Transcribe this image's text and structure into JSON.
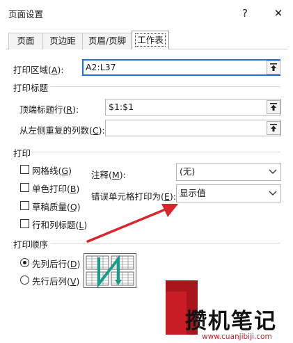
{
  "dialog": {
    "title": "页面设置",
    "help_button": "?",
    "close_button": "✕"
  },
  "tabs": [
    {
      "label": "页面"
    },
    {
      "label": "页边距"
    },
    {
      "label": "页眉/页脚"
    },
    {
      "label": "工作表",
      "active": true
    }
  ],
  "print_area": {
    "label": "打印区域",
    "hotkey": "A",
    "value": "A2:L37"
  },
  "print_titles": {
    "section": "打印标题",
    "rows_label": "顶端标题行",
    "rows_hotkey": "R",
    "rows_value": "$1:$1",
    "cols_label": "从左侧重复的列数",
    "cols_hotkey": "C",
    "cols_value": ""
  },
  "print": {
    "section": "打印",
    "checkboxes": [
      {
        "label": "网格线",
        "hotkey": "G",
        "checked": false
      },
      {
        "label": "单色打印",
        "hotkey": "B",
        "checked": false
      },
      {
        "label": "草稿质量",
        "hotkey": "Q",
        "checked": false
      },
      {
        "label": "行和列标题",
        "hotkey": "L",
        "checked": false
      }
    ],
    "comments_label": "注释",
    "comments_hotkey": "M",
    "comments_value": "(无)",
    "errors_label": "错误单元格打印为",
    "errors_hotkey": "E",
    "errors_value": "显示值"
  },
  "page_order": {
    "section": "打印顺序",
    "options": [
      {
        "label": "先列后行",
        "hotkey": "D",
        "checked": true
      },
      {
        "label": "先行后列",
        "hotkey": "V",
        "checked": false
      }
    ]
  },
  "watermark": {
    "text": "攒机笔记",
    "url": "www.cuanjibiji.com"
  },
  "colors": {
    "accent": "#1e6fd9",
    "arrow": "#d9262c",
    "order_arrow": "#1a9c8c",
    "watermark_red": "#c81d25"
  }
}
